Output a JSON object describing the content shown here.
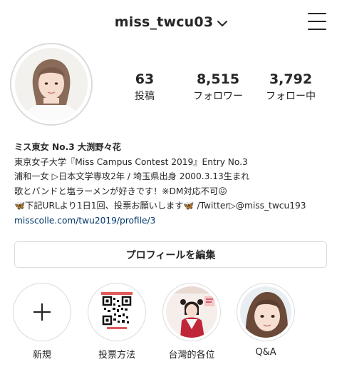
{
  "header": {
    "username": "miss_twcu03"
  },
  "stats": [
    {
      "value": "63",
      "label": "投稿"
    },
    {
      "value": "8,515",
      "label": "フォロワー"
    },
    {
      "value": "3,792",
      "label": "フォロー中"
    }
  ],
  "bio": {
    "name": "ミス東女 No.3 大渕野々花",
    "lines": [
      "東京女子大学『Miss Campus Contest 2019』Entry No.3",
      "浦和一女 ▷日本文学専攻2年 / 埼玉県出身 2000.3.13生まれ",
      "歌とバンドと塩ラーメンが好きです！※DM対応不可😖",
      "🦋下記URLより1日1回、投票お願いします🦋 /Twitter▷@miss_twcu193"
    ],
    "link": "misscolle.com/twu2019/profile/3"
  },
  "edit_profile_label": "プロフィールを編集",
  "highlights": [
    {
      "label": "新規",
      "icon": "plus-icon"
    },
    {
      "label": "投票方法",
      "icon": "qr-code"
    },
    {
      "label": "台灣的各位",
      "icon": "photo"
    },
    {
      "label": "Q&A",
      "icon": "photo"
    }
  ],
  "colors": {
    "text": "#262626",
    "link": "#00376b",
    "border": "#dbdbdb"
  }
}
